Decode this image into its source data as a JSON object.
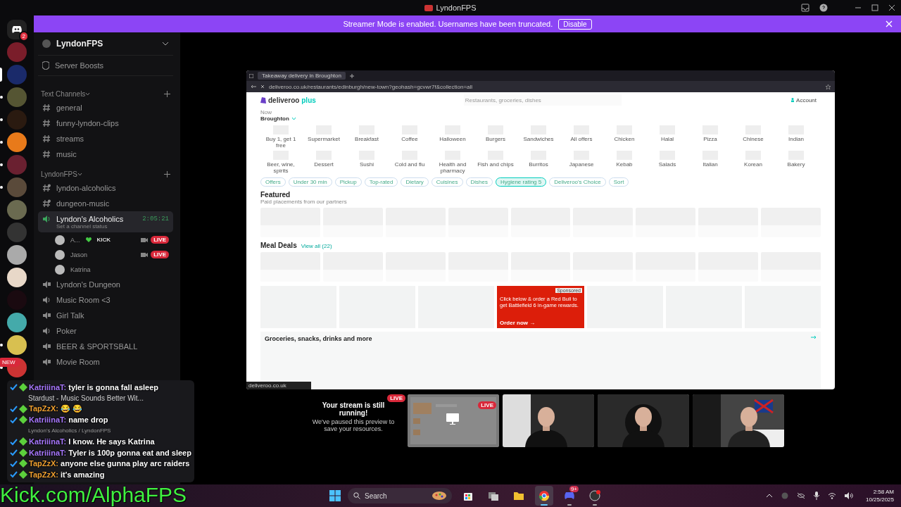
{
  "window": {
    "title": "LyndonFPS"
  },
  "banner": {
    "message": "Streamer Mode is enabled. Usernames have been truncated.",
    "button": "Disable"
  },
  "servers": [
    {
      "kind": "home",
      "badge": "2",
      "selected": false,
      "unread": false
    },
    {
      "kind": "server",
      "selected": false,
      "unread": false
    },
    {
      "kind": "server",
      "selected": true,
      "unread": false
    },
    {
      "kind": "server",
      "selected": false,
      "unread": true
    },
    {
      "kind": "server",
      "selected": false,
      "unread": true
    },
    {
      "kind": "server",
      "selected": false,
      "unread": true
    },
    {
      "kind": "server",
      "selected": false,
      "unread": true
    },
    {
      "kind": "server",
      "selected": false,
      "unread": true
    },
    {
      "kind": "server",
      "selected": false,
      "unread": false
    },
    {
      "kind": "server",
      "selected": false,
      "unread": false
    },
    {
      "kind": "server",
      "selected": false,
      "unread": false
    },
    {
      "kind": "server",
      "selected": false,
      "unread": false
    },
    {
      "kind": "server",
      "selected": false,
      "unread": false
    },
    {
      "kind": "server",
      "selected": false,
      "unread": false
    },
    {
      "kind": "server",
      "selected": false,
      "unread": true
    },
    {
      "kind": "server",
      "selected": false,
      "unread": true,
      "tag": "NEW"
    }
  ],
  "sidebar": {
    "server_name": "LyndonFPS",
    "boosts": "Server Boosts",
    "categories": [
      {
        "name": "Text Channels",
        "channels": [
          {
            "kind": "text",
            "name": "general"
          },
          {
            "kind": "text",
            "name": "funny-lyndon-clips"
          },
          {
            "kind": "text",
            "name": "streams"
          },
          {
            "kind": "text",
            "name": "music"
          }
        ]
      },
      {
        "name": "LyndonFPS",
        "channels": [
          {
            "kind": "text-locked",
            "name": "lyndon-alcoholics"
          },
          {
            "kind": "text-locked",
            "name": "dungeon-music"
          },
          {
            "kind": "voice",
            "name": "Lyndon's Alcoholics",
            "selected": true,
            "timer": "2:05:21",
            "status": "Set a channel status",
            "members": [
              {
                "name": "A...",
                "tag": "KICK",
                "camera": true,
                "badge": "LIVE"
              },
              {
                "name": "Jason",
                "camera": true,
                "badge": "LIVE"
              },
              {
                "name": "Katrina",
                "camera": false
              }
            ]
          },
          {
            "kind": "voice-locked",
            "name": "Lyndon's Dungeon",
            "selected": false
          },
          {
            "kind": "voice",
            "name": "Music Room <3",
            "selected": false
          },
          {
            "kind": "voice-locked",
            "name": "Girl Talk",
            "selected": false
          },
          {
            "kind": "voice",
            "name": "Poker",
            "selected": false
          },
          {
            "kind": "voice-locked",
            "name": "BEER & SPORTSBALL",
            "selected": false
          },
          {
            "kind": "voice-locked",
            "name": "Movie Room",
            "selected": false
          }
        ]
      }
    ]
  },
  "chat_overlay": [
    {
      "kind": "message",
      "user": "KatriiinaT:",
      "color": "#a878ff",
      "text": "tyler is gonna fall asleep"
    },
    {
      "kind": "track",
      "text": "Stardust - Music Sounds Better Wit..."
    },
    {
      "kind": "message",
      "user": "TapZzX:",
      "color": "#f0a030",
      "text": "😂 😂"
    },
    {
      "kind": "message",
      "user": "KatriiinaT:",
      "color": "#a878ff",
      "text": "name drop"
    },
    {
      "kind": "location",
      "text": "Lyndon's Alcoholics / LyndonFPS"
    },
    {
      "kind": "message",
      "user": "KatriiinaT:",
      "color": "#a878ff",
      "text": "I know. He says Katrina"
    },
    {
      "kind": "message",
      "user": "KatriiinaT:",
      "color": "#a878ff",
      "text": "Tyler is 100p gonna eat and sleep"
    },
    {
      "kind": "message",
      "user": "TapZzX:",
      "color": "#f0a030",
      "text": "anyone else gunna play arc raiders"
    },
    {
      "kind": "message",
      "user": "TapZzX:",
      "color": "#f0a030",
      "text": "it's amazing"
    }
  ],
  "stream": {
    "browser": {
      "tab": "Takeaway delivery in Broughton",
      "url": "deliveroo.co.uk/restaurants/edinburgh/new-town?geohash=gcvwr7f&collection=all",
      "status_url": "deliveroo.co.uk",
      "page": {
        "logo": "deliveroo",
        "logo_suffix": "plus",
        "search_placeholder": "Restaurants, groceries, dishes",
        "account": "Account",
        "when": "Now",
        "location": "Broughton",
        "categories": [
          "Buy 1, get 1 free",
          "Supermarket",
          "Breakfast",
          "Coffee",
          "Halloween",
          "Burgers",
          "Sandwiches",
          "All offers",
          "Chicken",
          "Halal",
          "Pizza",
          "Chinese",
          "Indian",
          "Beer, wine, spirits",
          "Dessert",
          "Sushi",
          "Cold and flu",
          "Health and pharmacy",
          "Fish and chips",
          "Burritos",
          "Japanese",
          "Kebab",
          "Salads",
          "Italian",
          "Korean",
          "Bakery"
        ],
        "filters": [
          {
            "label": "Offers",
            "selected": false
          },
          {
            "label": "Under 30 min",
            "selected": false
          },
          {
            "label": "Pickup",
            "selected": false
          },
          {
            "label": "Top-rated",
            "selected": false
          },
          {
            "label": "Dietary",
            "selected": false
          },
          {
            "label": "Cuisines",
            "selected": false
          },
          {
            "label": "Dishes",
            "selected": false
          },
          {
            "label": "Hygiene rating 5",
            "selected": true
          },
          {
            "label": "Deliveroo's Choice",
            "selected": false
          },
          {
            "label": "Sort",
            "selected": false
          }
        ],
        "featured": {
          "title": "Featured",
          "subtitle": "Paid placements from our partners"
        },
        "meal_deals": {
          "title": "Meal Deals",
          "link": "View all (22)"
        },
        "ad": {
          "badge": "Sponsored",
          "text": "Click below & order a Red Bull to get Battlefield 6 in-game rewards.",
          "cta": "Order now →"
        },
        "groceries": "Groceries, snacks, drinks and more"
      }
    },
    "notice": {
      "title": "Your stream is still running!",
      "text": "We've paused this preview to save your resources.",
      "badge": "LIVE"
    },
    "tiles": [
      {
        "kind": "screen",
        "badge": "LIVE"
      },
      {
        "kind": "camera"
      },
      {
        "kind": "camera"
      },
      {
        "kind": "camera"
      }
    ]
  },
  "overlay_link": "Kick.com/AlphaFPS",
  "taskbar": {
    "search": "Search",
    "apps": [
      {
        "kind": "store"
      },
      {
        "kind": "taskview"
      },
      {
        "kind": "folder"
      },
      {
        "kind": "browser",
        "active": true
      },
      {
        "kind": "chat",
        "badge": "9+",
        "running": true
      },
      {
        "kind": "recorder",
        "running": true
      }
    ],
    "time": "2:58 AM",
    "date": "10/25/2025"
  }
}
